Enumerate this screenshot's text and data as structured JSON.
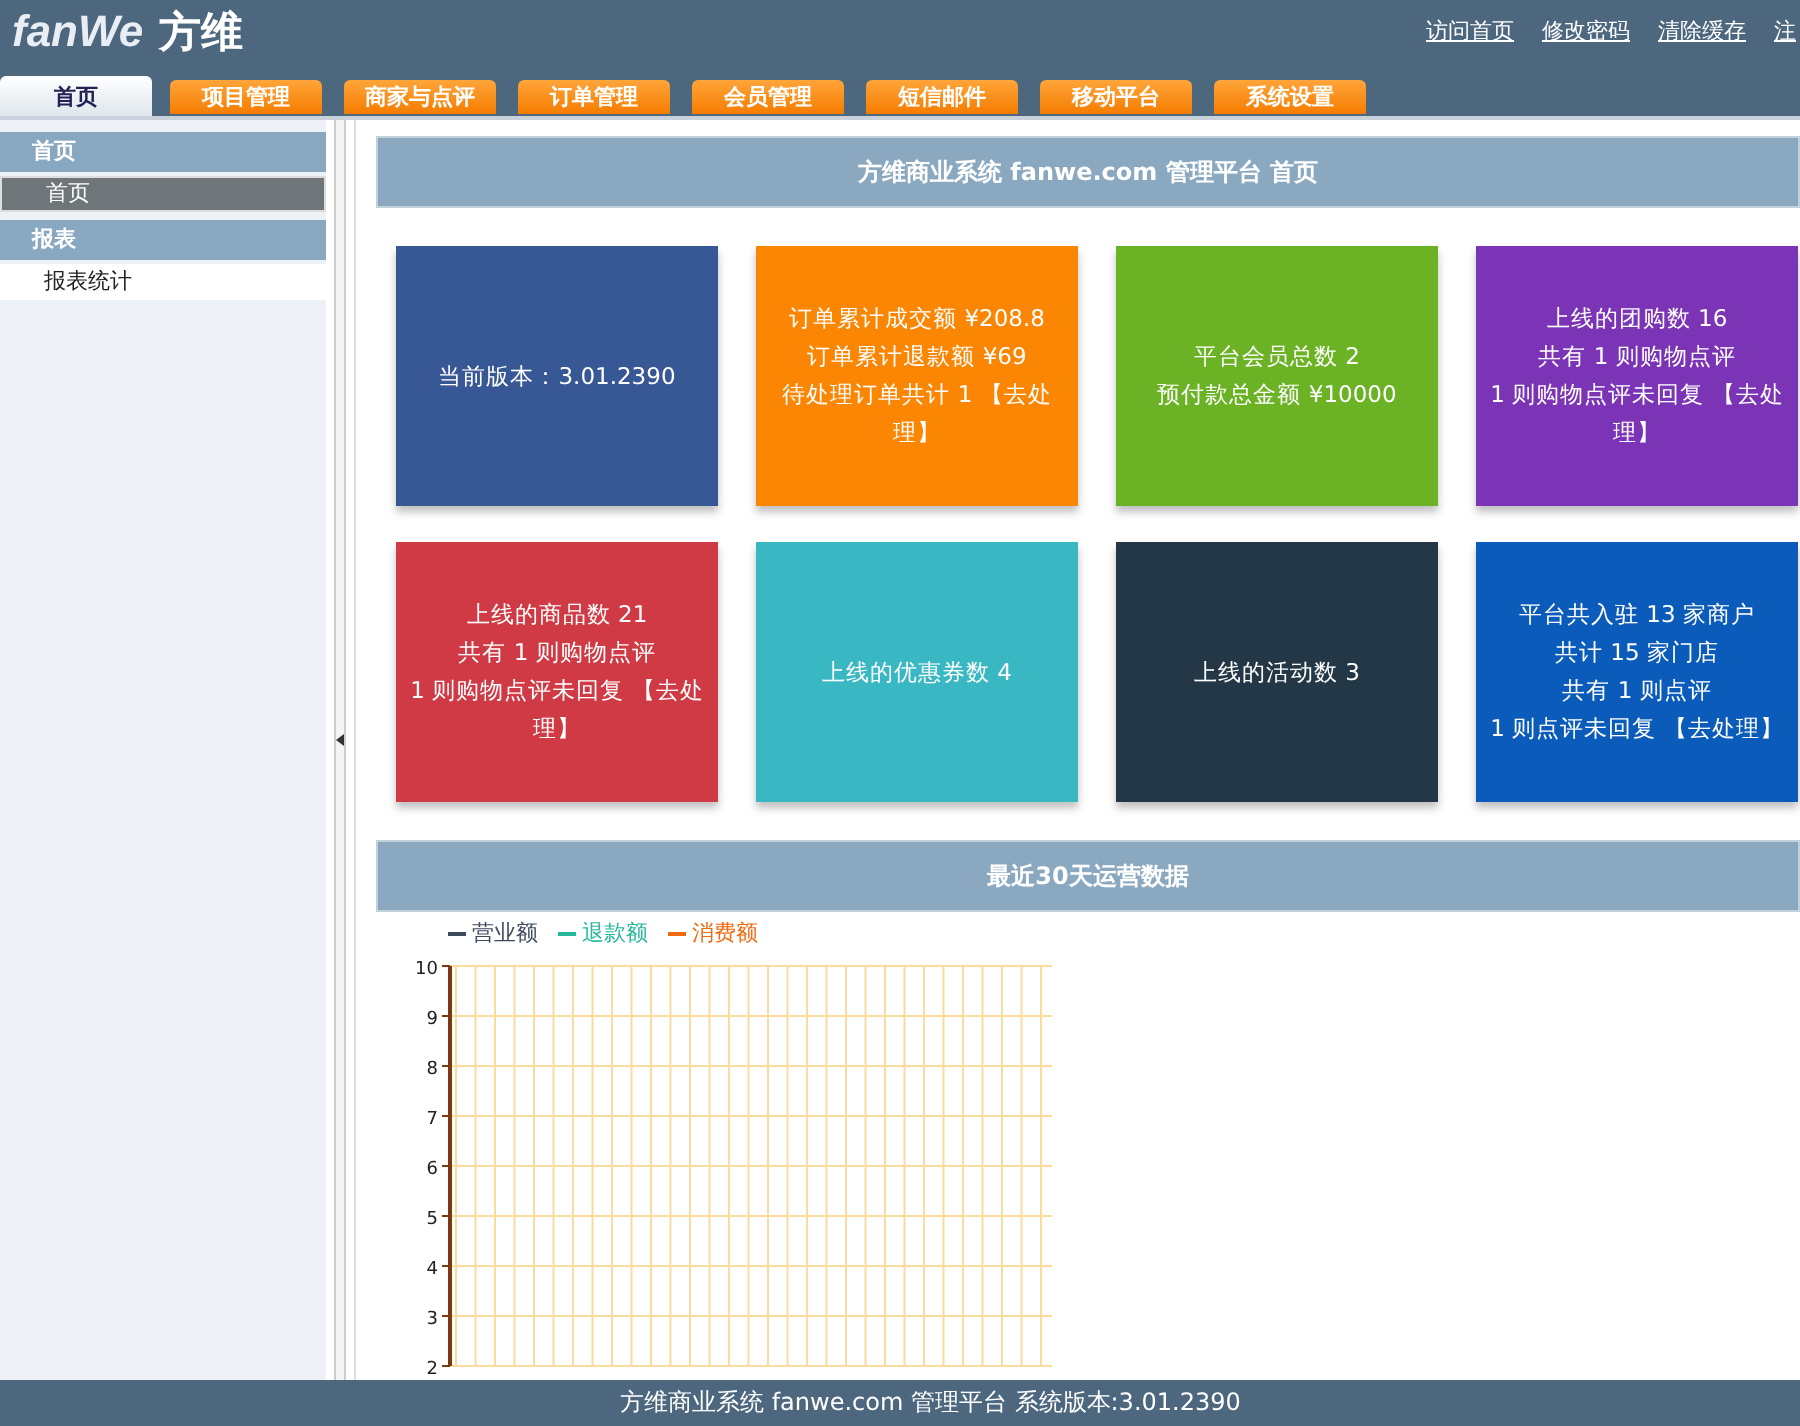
{
  "logo": {
    "latin": "fanWe",
    "chinese": "方维"
  },
  "top_links": [
    "访问首页",
    "修改密码",
    "清除缓存",
    "注"
  ],
  "tabs": [
    {
      "label": "首页",
      "selected": true
    },
    {
      "label": "项目管理",
      "selected": false
    },
    {
      "label": "商家与点评",
      "selected": false
    },
    {
      "label": "订单管理",
      "selected": false
    },
    {
      "label": "会员管理",
      "selected": false
    },
    {
      "label": "短信邮件",
      "selected": false
    },
    {
      "label": "移动平台",
      "selected": false
    },
    {
      "label": "系统设置",
      "selected": false
    }
  ],
  "sidebar": {
    "groups": [
      {
        "title": "首页",
        "items": [
          {
            "label": "首页",
            "selected": true
          }
        ]
      },
      {
        "title": "报表",
        "items": [
          {
            "label": "报表统计",
            "selected": false
          }
        ]
      }
    ]
  },
  "main_title": "方维商业系统 fanwe.com 管理平台 首页",
  "cards": [
    {
      "color": "#385795",
      "lines": [
        "当前版本：3.01.2390"
      ]
    },
    {
      "color": "#fb8604",
      "lines": [
        "订单累计成交额 ¥208.8",
        "订单累计退款额 ¥69",
        "待处理订单共计 1 【去处理】"
      ]
    },
    {
      "color": "#6bb325",
      "lines": [
        "平台会员总数 2",
        "预付款总金额 ¥10000"
      ]
    },
    {
      "color": "#7b34b6",
      "lines": [
        "上线的团购数 16",
        "共有 1 则购物点评",
        "1 则购物点评未回复 【去处理】"
      ]
    },
    {
      "color": "#d03a44",
      "lines": [
        "上线的商品数 21",
        "共有 1 则购物点评",
        "1 则购物点评未回复 【去处理】"
      ]
    },
    {
      "color": "#39b7c2",
      "lines": [
        "上线的优惠券数 4"
      ]
    },
    {
      "color": "#233746",
      "lines": [
        "上线的活动数 3"
      ]
    },
    {
      "color": "#0b5cba",
      "lines": [
        "平台共入驻 13 家商户",
        "共计 15 家门店",
        "共有 1 则点评",
        "1 则点评未回复 【去处理】"
      ]
    }
  ],
  "chart_section": {
    "title": "最近30天运营数据",
    "chart_data": {
      "type": "line",
      "series": [
        {
          "name": "营业额",
          "color": "#3d4a5c"
        },
        {
          "name": "退款额",
          "color": "#25b89c"
        },
        {
          "name": "消费额",
          "color": "#f26a10"
        }
      ],
      "ylim": [
        2,
        10
      ],
      "grid": true,
      "yticks": [
        2,
        3,
        4,
        5,
        6,
        7,
        8,
        9,
        10
      ]
    }
  },
  "footer": "方维商业系统 fanwe.com 管理平台 系统版本:3.01.2390"
}
